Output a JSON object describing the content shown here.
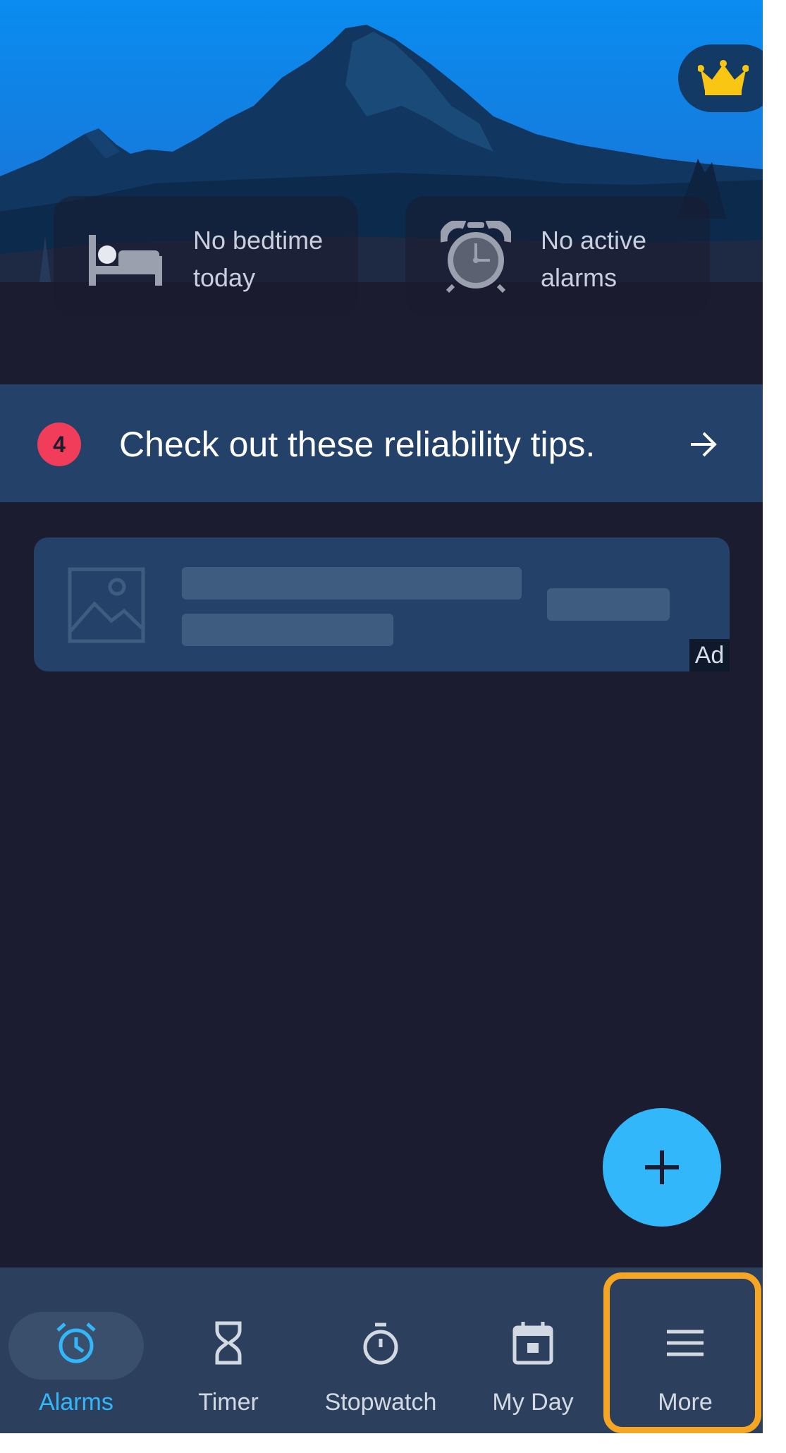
{
  "header": {
    "premium_icon": "crown-icon"
  },
  "summary": {
    "bedtime": {
      "icon": "bed-icon",
      "line1": "No bedtime",
      "line2": "today"
    },
    "alarms": {
      "icon": "alarm-clock-icon",
      "line1": "No active",
      "line2": "alarms"
    }
  },
  "tips": {
    "count": "4",
    "text": "Check out these reliability tips.",
    "arrow_icon": "arrow-right-icon"
  },
  "ad": {
    "label": "Ad",
    "image_icon": "image-placeholder-icon"
  },
  "fab": {
    "icon": "plus-icon"
  },
  "nav": {
    "items": [
      {
        "label": "Alarms",
        "icon": "alarm-icon",
        "active": true
      },
      {
        "label": "Timer",
        "icon": "hourglass-icon",
        "active": false
      },
      {
        "label": "Stopwatch",
        "icon": "stopwatch-icon",
        "active": false
      },
      {
        "label": "My Day",
        "icon": "calendar-icon",
        "active": false
      },
      {
        "label": "More",
        "icon": "menu-icon",
        "active": false,
        "highlighted": true
      }
    ]
  },
  "colors": {
    "background": "#1c1c30",
    "banner": "#24416a",
    "accent": "#32b7fb",
    "badge": "#f13d59",
    "nav_background": "#2c405e",
    "highlight": "#f6a623",
    "crown": "#f9c613"
  }
}
